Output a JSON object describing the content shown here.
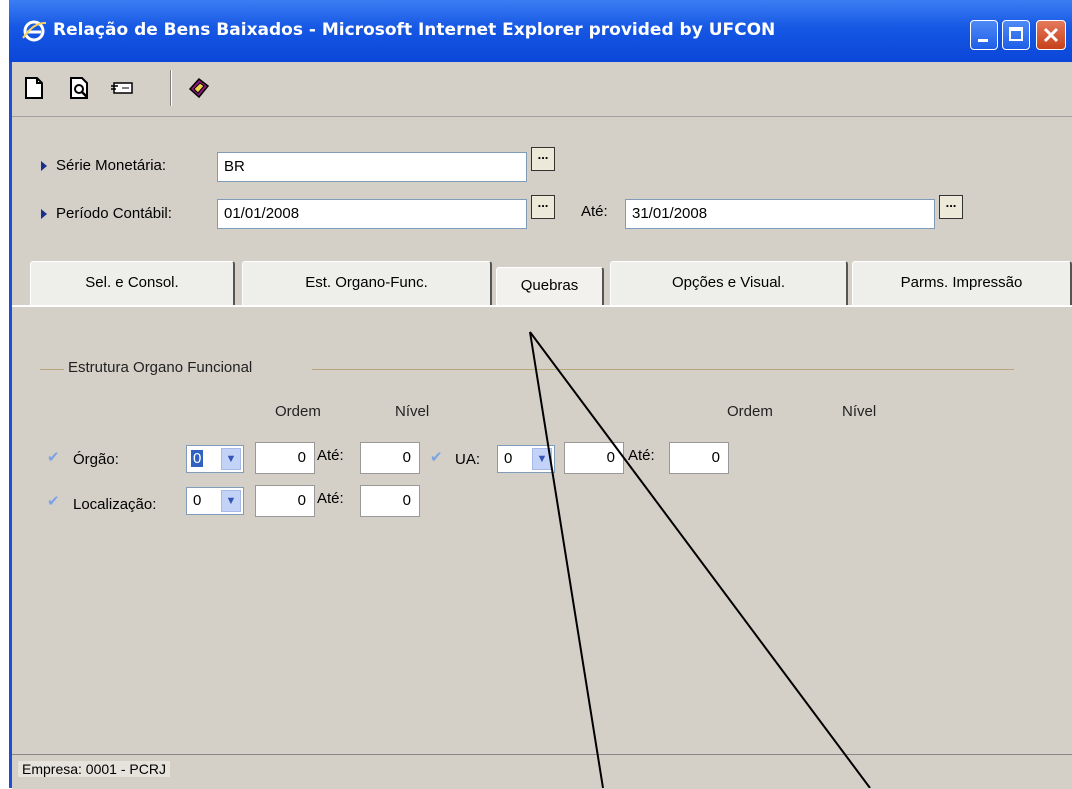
{
  "window": {
    "title": "Relação de Bens Baixados - Microsoft Internet Explorer provided by UFCON"
  },
  "toolbar": {
    "icons": [
      "new-document-icon",
      "print-preview-icon",
      "card-icon",
      "book-icon"
    ]
  },
  "form": {
    "serie_label": "Série Monetária:",
    "serie_value": "BR",
    "periodo_label": "Período Contábil:",
    "periodo_from": "01/01/2008",
    "ate_label": "Até:",
    "periodo_to": "31/01/2008",
    "browse_label": "..."
  },
  "tabs": [
    {
      "label": "Sel. e Consol.",
      "active": false
    },
    {
      "label": "Est. Organo-Func.",
      "active": false
    },
    {
      "label": "Quebras",
      "active": true
    },
    {
      "label": "Opções e Visual.",
      "active": false
    },
    {
      "label": "Parms. Impressão",
      "active": false
    }
  ],
  "group": {
    "title": "Estrutura Organo Funcional",
    "col_ordem": "Ordem",
    "col_nivel": "Nível",
    "orgao_label": "Órgão:",
    "orgao_select": "0",
    "orgao_ordem": "0",
    "orgao_ate_label": "Até:",
    "orgao_nivel": "0",
    "ua_label": "UA:",
    "ua_select": "0",
    "ua_ordem": "0",
    "ua_ate_label": "Até:",
    "ua_nivel": "0",
    "localizacao_label": "Localização:",
    "localizacao_select": "0",
    "localizacao_ordem": "0",
    "localizacao_ate_label": "Até:",
    "localizacao_nivel": "0"
  },
  "status": {
    "text": "Empresa: 0001 - PCRJ"
  },
  "colors": {
    "titlebar": "#0b46d8",
    "client_bg": "#d4d0c8",
    "check": "#7aa3e6"
  }
}
